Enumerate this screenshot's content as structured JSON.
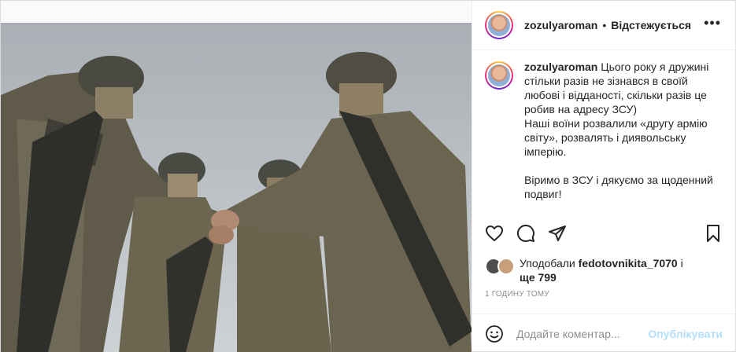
{
  "header": {
    "username": "zozulyaroman",
    "separator": "•",
    "follow_state": "Відстежується",
    "more_icon": "more-horizontal-icon"
  },
  "caption": {
    "username": "zozulyaroman",
    "line1": "Цього року я дружині стільки разів не зізнався в своїй любові і відданості, скільки разів це робив на адресу ЗСУ)",
    "line2": "Наші воїни розвалили «другу армію світу», розвалять і диявольську імперію.",
    "line3": "Віримо в ЗСУ і дякуємо за щоденний подвиг!"
  },
  "actions": {
    "like_icon": "heart-icon",
    "comment_icon": "comment-icon",
    "share_icon": "paper-plane-icon",
    "save_icon": "bookmark-icon"
  },
  "likes": {
    "prefix": "Уподобали",
    "user": "fedotovnikita_7070",
    "conj": "і",
    "rest": "ще 799"
  },
  "time": "1 ГОДИНУ ТОМУ",
  "comment": {
    "placeholder": "Додайте коментар...",
    "publish_label": "Опублікувати",
    "emoji_icon": "smile-icon"
  },
  "colors": {
    "border": "#dbdbdb",
    "publish_disabled": "#b2dffc",
    "muted": "#8e8e8e"
  }
}
